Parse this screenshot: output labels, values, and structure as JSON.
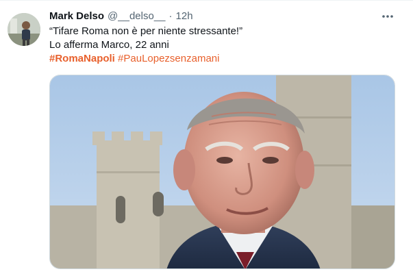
{
  "tweet": {
    "author_name": "Mark Delso",
    "handle": "@__delso__",
    "separator": "·",
    "time": "12h",
    "text_line_1": "“Tifare Roma non è per niente stressante!”",
    "text_line_2": "Lo afferma Marco, 22 anni",
    "hashtag_1": "#RomaNapoli",
    "hashtag_2": "#PauLopezsenzamani"
  },
  "icons": {
    "more": "more-horizontal-icon",
    "avatar": "profile-photo"
  },
  "colors": {
    "hashtag": "#e8602c",
    "secondary_text": "#536471",
    "primary_text": "#0f1419",
    "border": "#cfd9de"
  }
}
